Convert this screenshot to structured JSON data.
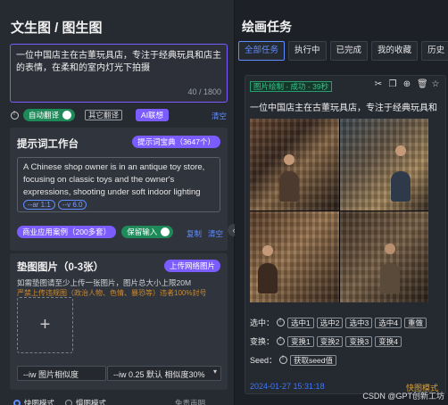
{
  "left": {
    "title": "文生图 / 图生图",
    "prompt": {
      "value": "一位中国店主在古董玩具店，专注于经典玩具和店主的表情，在柔和的室内灯光下拍摄",
      "count": "40 / 1800"
    },
    "options": {
      "auto_translate_label": "自动翻译",
      "other_translate": "其它翻译",
      "ai_imagine": "AI联想",
      "clear": "清空"
    },
    "tip_card": {
      "title": "提示词工作台",
      "dict_button": "提示词宝典（3647个）",
      "text": "A Chinese shop owner is in an antique toy store, focusing on classic toys and the owner's expressions, shooting under soft indoor lighting",
      "chips": [
        "--ar 1:1",
        "--v 6.0"
      ],
      "commercial_btn": "商业应用案例（200多套）",
      "keep_input": "保留输入",
      "copy": "复制",
      "clear": "清空"
    },
    "ref_card": {
      "title": "垫图图片（0-3张）",
      "upload_btn": "上传网络图片",
      "hint": "如需垫图请至少上传一张图片，图片总大小上限20M",
      "warn": "严禁上传违规图（政治人物、色情、暴恐等）违者100%封号",
      "add": "+",
      "iw_label": "--iw 图片相似度",
      "iw_value": "--iw 0.25 默认 相似度30%"
    },
    "footer": {
      "fast_mode": "快图模式",
      "slow_mode": "慢图模式",
      "disclaimer": "免责声明"
    }
  },
  "right": {
    "title": "绘画任务",
    "tabs": [
      "全部任务",
      "执行中",
      "已完成",
      "我的收藏",
      "历史"
    ],
    "task": {
      "status": "图片绘制 - 成功 - 39秒",
      "prompt": "一位中国店主在古董玩具店，专注于经典玩具和",
      "select_label": "选中：",
      "select_btns": [
        "选中1",
        "选中2",
        "选中3",
        "选中4",
        "重做"
      ],
      "vary_label": "变换：",
      "vary_btns": [
        "变换1",
        "变换2",
        "变换3",
        "变换4"
      ],
      "seed_label": "Seed：",
      "seed_btn": "获取seed值",
      "time": "2024-01-27 15:31:18",
      "link": "快图模式"
    }
  },
  "watermark": "CSDN @GPT创新工坊"
}
